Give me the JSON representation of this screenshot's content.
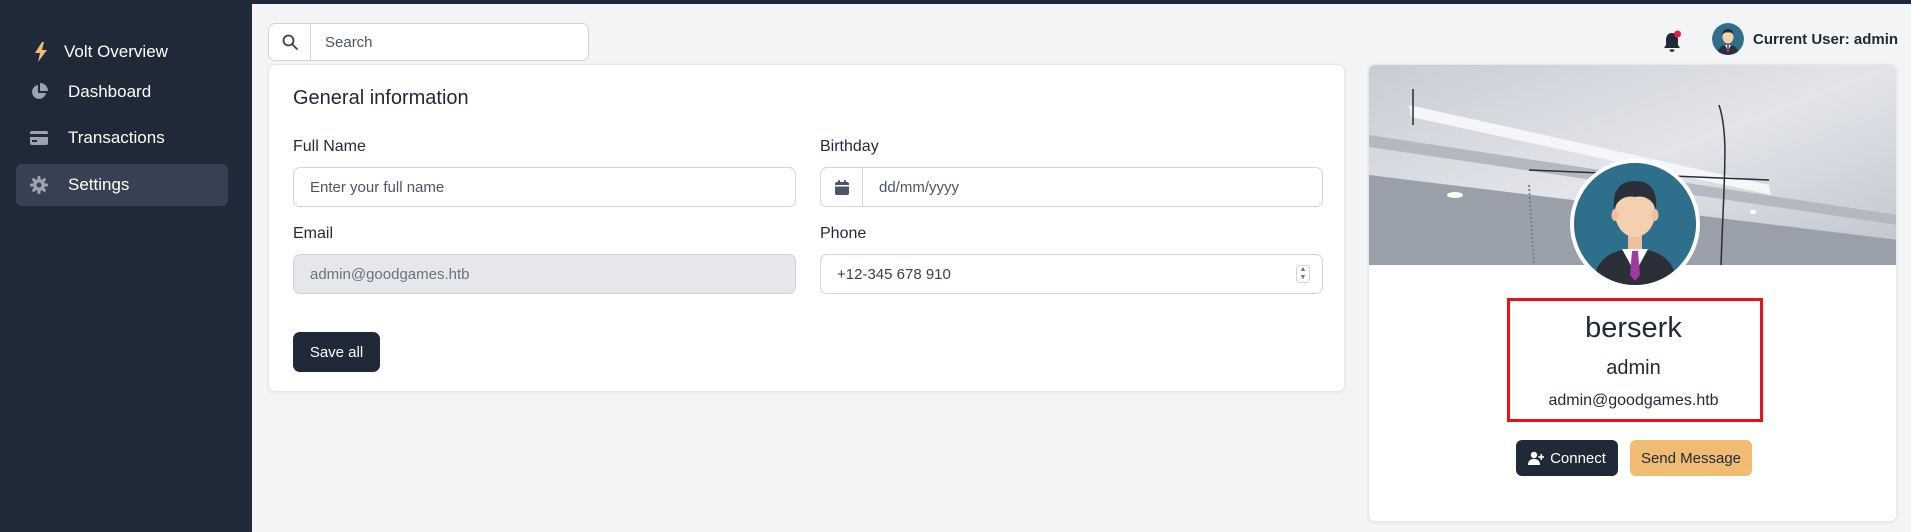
{
  "sidebar": {
    "brand": {
      "label": "Volt Overview",
      "icon": "bolt-icon"
    },
    "items": [
      {
        "label": "Dashboard",
        "icon": "pie-chart-icon",
        "active": false
      },
      {
        "label": "Transactions",
        "icon": "credit-card-icon",
        "active": false
      },
      {
        "label": "Settings",
        "icon": "gear-icon",
        "active": true
      }
    ]
  },
  "header": {
    "search": {
      "placeholder": "Search",
      "value": ""
    },
    "notification": {
      "icon": "bell-icon",
      "has_unread": true
    },
    "user_label": "Current User: admin"
  },
  "general": {
    "title": "General information",
    "full_name": {
      "label": "Full Name",
      "placeholder": "Enter your full name",
      "value": ""
    },
    "birthday": {
      "label": "Birthday",
      "placeholder": "dd/mm/yyyy",
      "value": ""
    },
    "email": {
      "label": "Email",
      "value": "admin@goodgames.htb",
      "disabled": true
    },
    "phone": {
      "label": "Phone",
      "value": "+12-345 678 910"
    },
    "save_label": "Save all"
  },
  "profile": {
    "name": "berserk",
    "role": "admin",
    "email": "admin@goodgames.htb",
    "connect_label": "Connect",
    "message_label": "Send Message"
  },
  "colors": {
    "sidebar_bg": "#1f2937",
    "sidebar_active": "#374151",
    "page_bg": "#f2f4f6",
    "primary": "#1f2937",
    "secondary_button": "#f0bc74",
    "highlight_border": "#e5141b",
    "notification_dot": "#e11d48",
    "brand_icon": "#f0bc74"
  }
}
